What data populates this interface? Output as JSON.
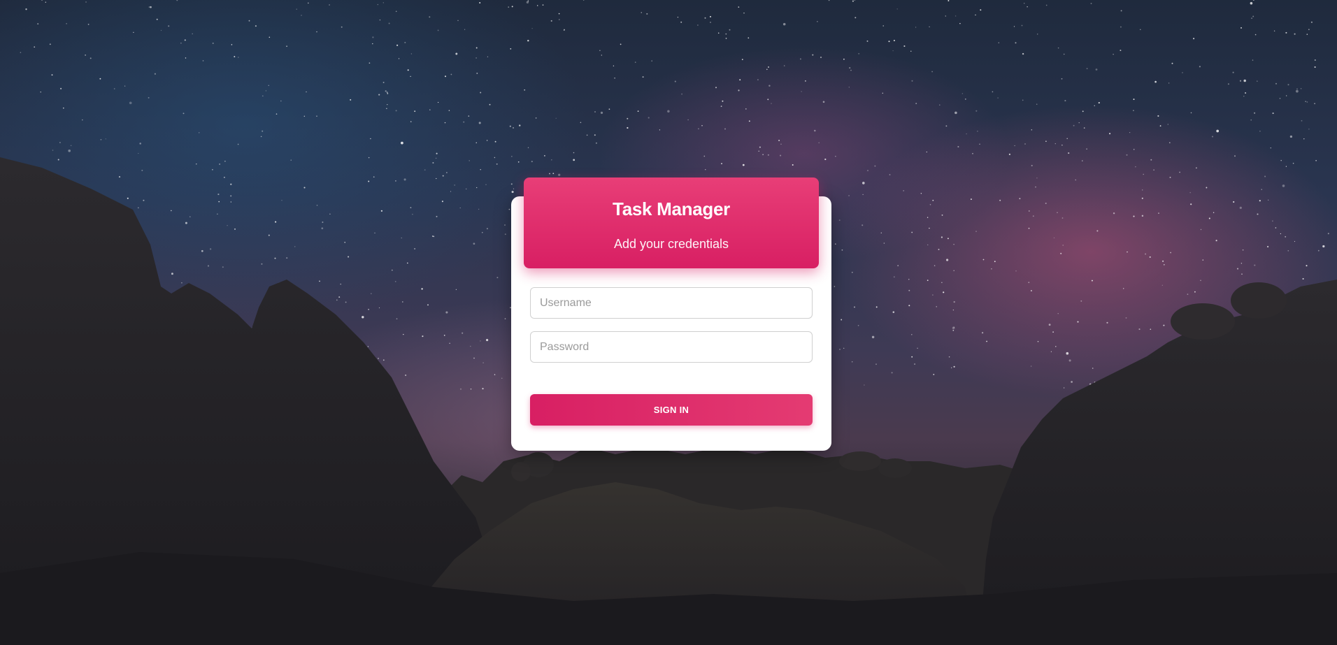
{
  "app": {
    "title": "Task Manager",
    "subtitle": "Add your credentials"
  },
  "form": {
    "username": {
      "placeholder": "Username",
      "value": ""
    },
    "password": {
      "placeholder": "Password",
      "value": ""
    },
    "submit_label": "SIGN IN"
  },
  "colors": {
    "accent": "#e0246b",
    "accent_light": "#e83e77",
    "card_background": "#ffffff",
    "field_border": "#cfcfcf"
  }
}
